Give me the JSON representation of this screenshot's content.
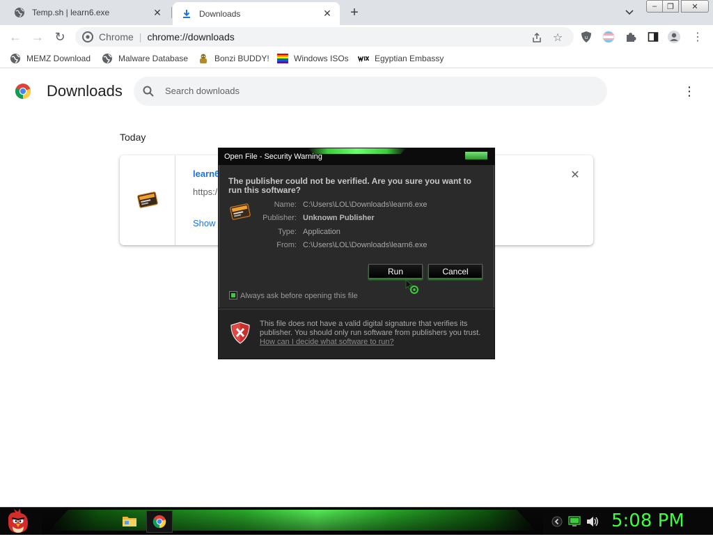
{
  "tabs": [
    {
      "title": "Temp.sh | learn6.exe",
      "close": "✕"
    },
    {
      "title": "Downloads",
      "close": "✕"
    }
  ],
  "new_tab_symbol": "+",
  "window_controls": {
    "minimize": "–",
    "maximize": "❐",
    "close": "✕"
  },
  "toolbar": {
    "back_symbol": "←",
    "forward_symbol": "→",
    "reload_symbol": "↻",
    "omnibox_site": "Chrome",
    "omnibox_separator": "|",
    "omnibox_url": "chrome://downloads",
    "menu_symbol": "⋮"
  },
  "bookmarks": [
    {
      "label": "MEMZ Download",
      "icon": "globe-icon"
    },
    {
      "label": "Malware Database",
      "icon": "globe-icon"
    },
    {
      "label": "Bonzi BUDDY!",
      "icon": "bonzi-icon"
    },
    {
      "label": "Windows ISOs",
      "icon": "rainbow-flag-icon"
    },
    {
      "label": "Egyptian Embassy",
      "icon": "wix-icon"
    }
  ],
  "downloads_page": {
    "title": "Downloads",
    "search_placeholder": "Search downloads",
    "menu_symbol": "⋮",
    "section_label": "Today",
    "item": {
      "file_name": "learn6",
      "url": "https:/",
      "show_link": "Show",
      "remove_symbol": "✕"
    }
  },
  "security_dialog": {
    "title": "Open File - Security Warning",
    "question": "The publisher could not be verified.  Are you sure you want to run this software?",
    "fields": [
      {
        "key": "Name:",
        "value": "C:\\Users\\LOL\\Downloads\\learn6.exe"
      },
      {
        "key": "Publisher:",
        "value": "Unknown Publisher"
      },
      {
        "key": "Type:",
        "value": "Application"
      },
      {
        "key": "From:",
        "value": "C:\\Users\\LOL\\Downloads\\learn6.exe"
      }
    ],
    "run_label": "Run",
    "cancel_label": "Cancel",
    "checkbox_label": "Always ask before opening this file",
    "checkbox_checked": true,
    "warning_text": "This file does not have a valid digital signature that verifies its publisher.  You should only run software from publishers you trust.",
    "help_link": "How can I decide what software to run?"
  },
  "taskbar": {
    "clock": "5:08 PM"
  },
  "colors": {
    "accent_green": "#3cff3c",
    "link_blue": "#1a73e8",
    "tab_strip": "#dee1e6",
    "dialog_bg": "#2a2a2a"
  }
}
